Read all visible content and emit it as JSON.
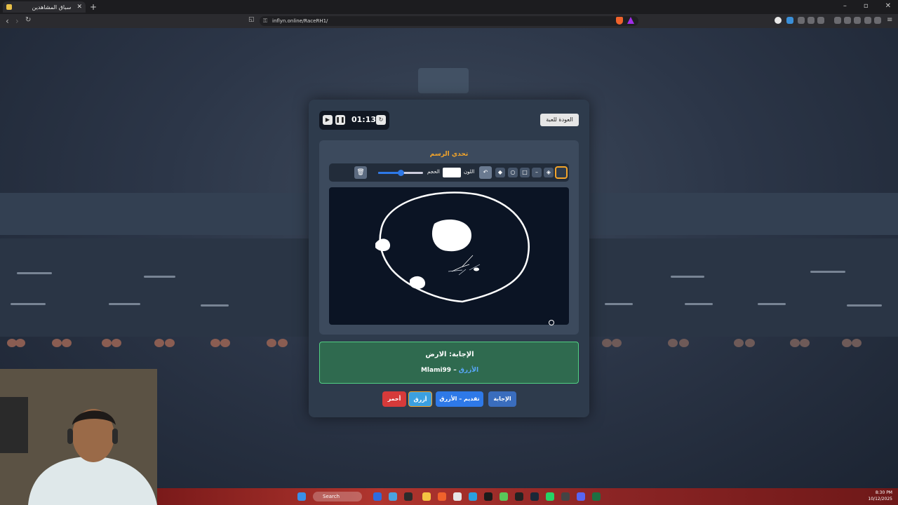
{
  "browser": {
    "tab_title": "سباق المشاهدين",
    "url": "inflyn.online/RaceRH1/"
  },
  "panel": {
    "timer": "01:13",
    "back_button": "العودة للعبة",
    "draw_title": "تحدي الرسم",
    "size_label": "الحجم",
    "color_label": "اللون",
    "size_value": 0.5,
    "answer_line": "الإجابة: الارض",
    "answer_user": "Mlami99",
    "answer_team": "الأزرق",
    "buttons": {
      "answer": "الإجابة",
      "submit_blue": "تقديم – الأزرق",
      "blue": "أزرق",
      "red": "أحمر"
    }
  },
  "taskbar": {
    "search_label": "Search",
    "time": "8:30 PM",
    "date": "10/12/2025"
  },
  "colors": {
    "accent": "#f4a52a",
    "answer_bg": "#2f6a4f",
    "blue_button": "#2e79e8",
    "red_button": "#d63a3a"
  }
}
